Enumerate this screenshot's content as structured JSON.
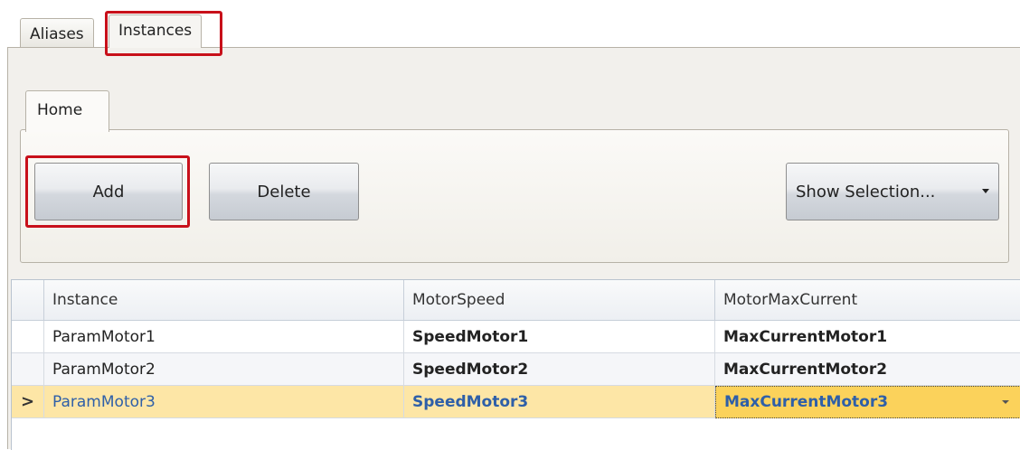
{
  "outer_tabs": [
    {
      "label": "Aliases",
      "active": false
    },
    {
      "label": "Instances",
      "active": true
    }
  ],
  "ribbon": {
    "tab_label": "Home",
    "add_label": "Add",
    "delete_label": "Delete",
    "show_selection_label": "Show Selection..."
  },
  "grid": {
    "columns": [
      "Instance",
      "MotorSpeed",
      "MotorMaxCurrent"
    ],
    "rows": [
      {
        "instance": "ParamMotor1",
        "speed": "SpeedMotor1",
        "current": "MaxCurrentMotor1"
      },
      {
        "instance": "ParamMotor2",
        "speed": "SpeedMotor2",
        "current": "MaxCurrentMotor2"
      },
      {
        "instance": "ParamMotor3",
        "speed": "SpeedMotor3",
        "current": "MaxCurrentMotor3",
        "selected": true
      }
    ],
    "current_row_indicator": ">"
  },
  "colors": {
    "highlight": "#c8101a",
    "selected_row": "#fde6a6",
    "selected_cell": "#fbd25b",
    "selected_text": "#2e5fa8"
  }
}
